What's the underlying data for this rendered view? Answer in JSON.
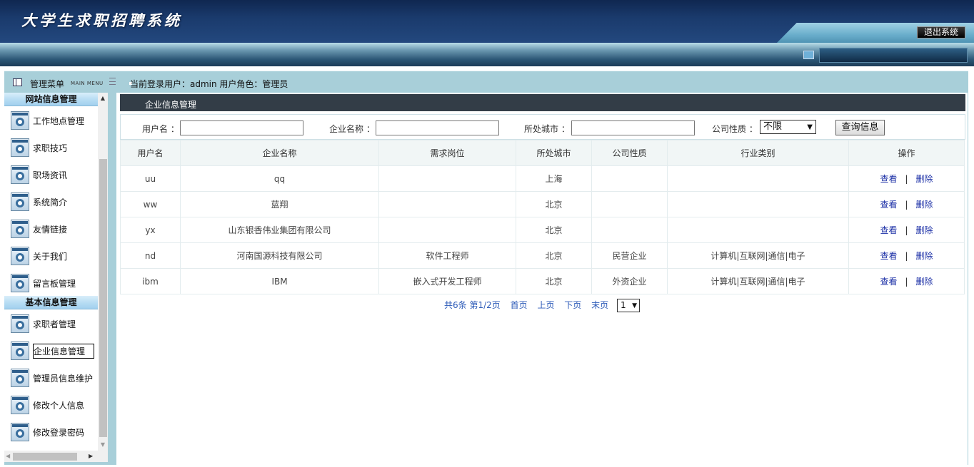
{
  "header": {
    "title": "大学生求职招聘系统",
    "logout_label": "退出系统"
  },
  "menu_head": {
    "title": "管理菜单",
    "subtitle": "MAIN MENU"
  },
  "userbar": {
    "text": "当前登录用户：admin  用户角色：管理员"
  },
  "menu": {
    "groups": [
      {
        "title": "网站信息管理",
        "items": [
          "工作地点管理",
          "求职技巧",
          "职场资讯",
          "系统简介",
          "友情链接",
          "关于我们",
          "留言板管理"
        ]
      },
      {
        "title": "基本信息管理",
        "items": [
          "求职者管理",
          "企业信息管理",
          "管理员信息维护",
          "修改个人信息",
          "修改登录密码"
        ]
      }
    ],
    "active_item": "企业信息管理"
  },
  "panel": {
    "title": "企业信息管理"
  },
  "search": {
    "username_label": "用户名 ：",
    "username_value": "",
    "company_label": "企业名称 ：",
    "company_value": "",
    "city_label": "所处城市 ：",
    "city_value": "",
    "nature_label": "公司性质 ：",
    "nature_selected": "不限",
    "submit_label": "查询信息"
  },
  "table": {
    "headers": [
      "用户名",
      "企业名称",
      "需求岗位",
      "所处城市",
      "公司性质",
      "行业类别",
      "操作"
    ],
    "rows": [
      {
        "user": "uu",
        "company": "qq",
        "position": "",
        "city": "上海",
        "nature": "",
        "industry": ""
      },
      {
        "user": "ww",
        "company": "蓝翔",
        "position": "",
        "city": "北京",
        "nature": "",
        "industry": ""
      },
      {
        "user": "yx",
        "company": "山东银香伟业集团有限公司",
        "position": "",
        "city": "北京",
        "nature": "",
        "industry": ""
      },
      {
        "user": "nd",
        "company": "河南国源科技有限公司",
        "position": "软件工程师",
        "city": "北京",
        "nature": "民营企业",
        "industry": "计算机|互联网|通信|电子"
      },
      {
        "user": "ibm",
        "company": "IBM",
        "position": "嵌入式开发工程师",
        "city": "北京",
        "nature": "外资企业",
        "industry": "计算机|互联网|通信|电子"
      }
    ],
    "action_view": "查看",
    "action_sep": "|",
    "action_delete": "删除"
  },
  "pager": {
    "summary": "共6条  第1/2页",
    "first": "首页",
    "prev": "上页",
    "next": "下页",
    "last": "末页",
    "page_selected": "1"
  }
}
